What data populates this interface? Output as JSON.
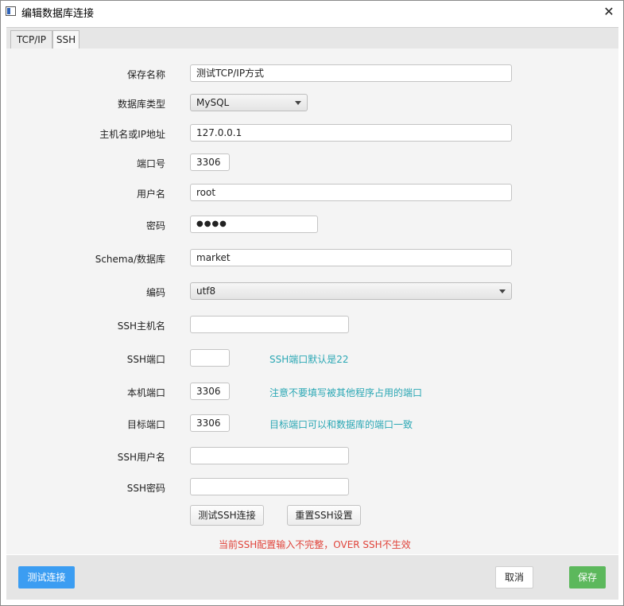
{
  "window": {
    "title": "编辑数据库连接",
    "close_glyph": "✕"
  },
  "tabs": [
    {
      "label": "TCP/IP",
      "active": false
    },
    {
      "label": "SSH",
      "active": true
    }
  ],
  "form": {
    "save_name": {
      "label": "保存名称",
      "value": "测试TCP/IP方式"
    },
    "db_type": {
      "label": "数据库类型",
      "value": "MySQL"
    },
    "host": {
      "label": "主机名或IP地址",
      "value": "127.0.0.1"
    },
    "port": {
      "label": "端口号",
      "value": "3306"
    },
    "username": {
      "label": "用户名",
      "value": "root"
    },
    "password": {
      "label": "密码",
      "value": "●●●●"
    },
    "schema": {
      "label": "Schema/数据库",
      "value": "market"
    },
    "encoding": {
      "label": "编码",
      "value": "utf8"
    },
    "ssh_host": {
      "label": "SSH主机名",
      "value": ""
    },
    "ssh_port": {
      "label": "SSH端口",
      "value": "",
      "hint": "SSH端口默认是22"
    },
    "local_port": {
      "label": "本机端口",
      "value": "3306",
      "hint": "注意不要填写被其他程序占用的端口"
    },
    "target_port": {
      "label": "目标端口",
      "value": "3306",
      "hint": "目标端口可以和数据库的端口一致"
    },
    "ssh_user": {
      "label": "SSH用户名",
      "value": ""
    },
    "ssh_password": {
      "label": "SSH密码",
      "value": ""
    }
  },
  "buttons": {
    "test_ssh": "测试SSH连接",
    "reset_ssh": "重置SSH设置",
    "test_connection": "测试连接",
    "cancel": "取消",
    "save": "保存"
  },
  "warning": "当前SSH配置输入不完整，OVER SSH不生效",
  "colors": {
    "hint": "#2aa7b4",
    "warning": "#e0443b",
    "primary": "#3b9df2",
    "success": "#5cb85c"
  }
}
